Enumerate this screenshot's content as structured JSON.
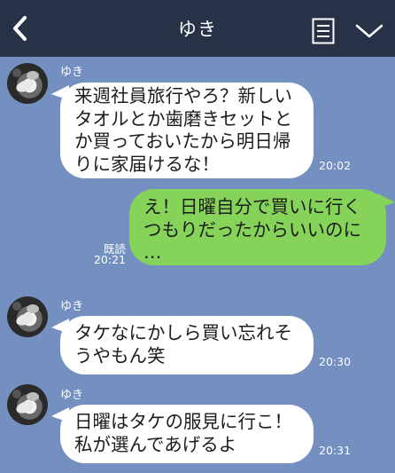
{
  "header": {
    "title": "ゆき",
    "colors": {
      "bar": "#273246",
      "background": "#7390c0"
    },
    "icons": {
      "back": "back-arrow-icon",
      "note": "note-icon",
      "menu": "chevron-down-icon"
    }
  },
  "messages": [
    {
      "sender": "ゆき",
      "side": "left",
      "lines": [
        "来週社員旅行やろ？新しい",
        "タオルとか歯磨きセットと",
        "か買っておいたから明日帰",
        "りに家届けるな！"
      ],
      "time": "20:02"
    },
    {
      "side": "right",
      "lines": [
        "え！日曜自分で買いに行く",
        "つもりだったからいいのに",
        "…"
      ],
      "read": "既読",
      "time": "20:21"
    },
    {
      "sender": "ゆき",
      "side": "left",
      "lines": [
        "タケなにかしら買い忘れそ",
        "うやもん笑"
      ],
      "time": "20:30"
    },
    {
      "sender": "ゆき",
      "side": "left",
      "lines": [
        "日曜はタケの服見に行こ！",
        "私が選んであげるよ"
      ],
      "time": "20:31"
    }
  ]
}
